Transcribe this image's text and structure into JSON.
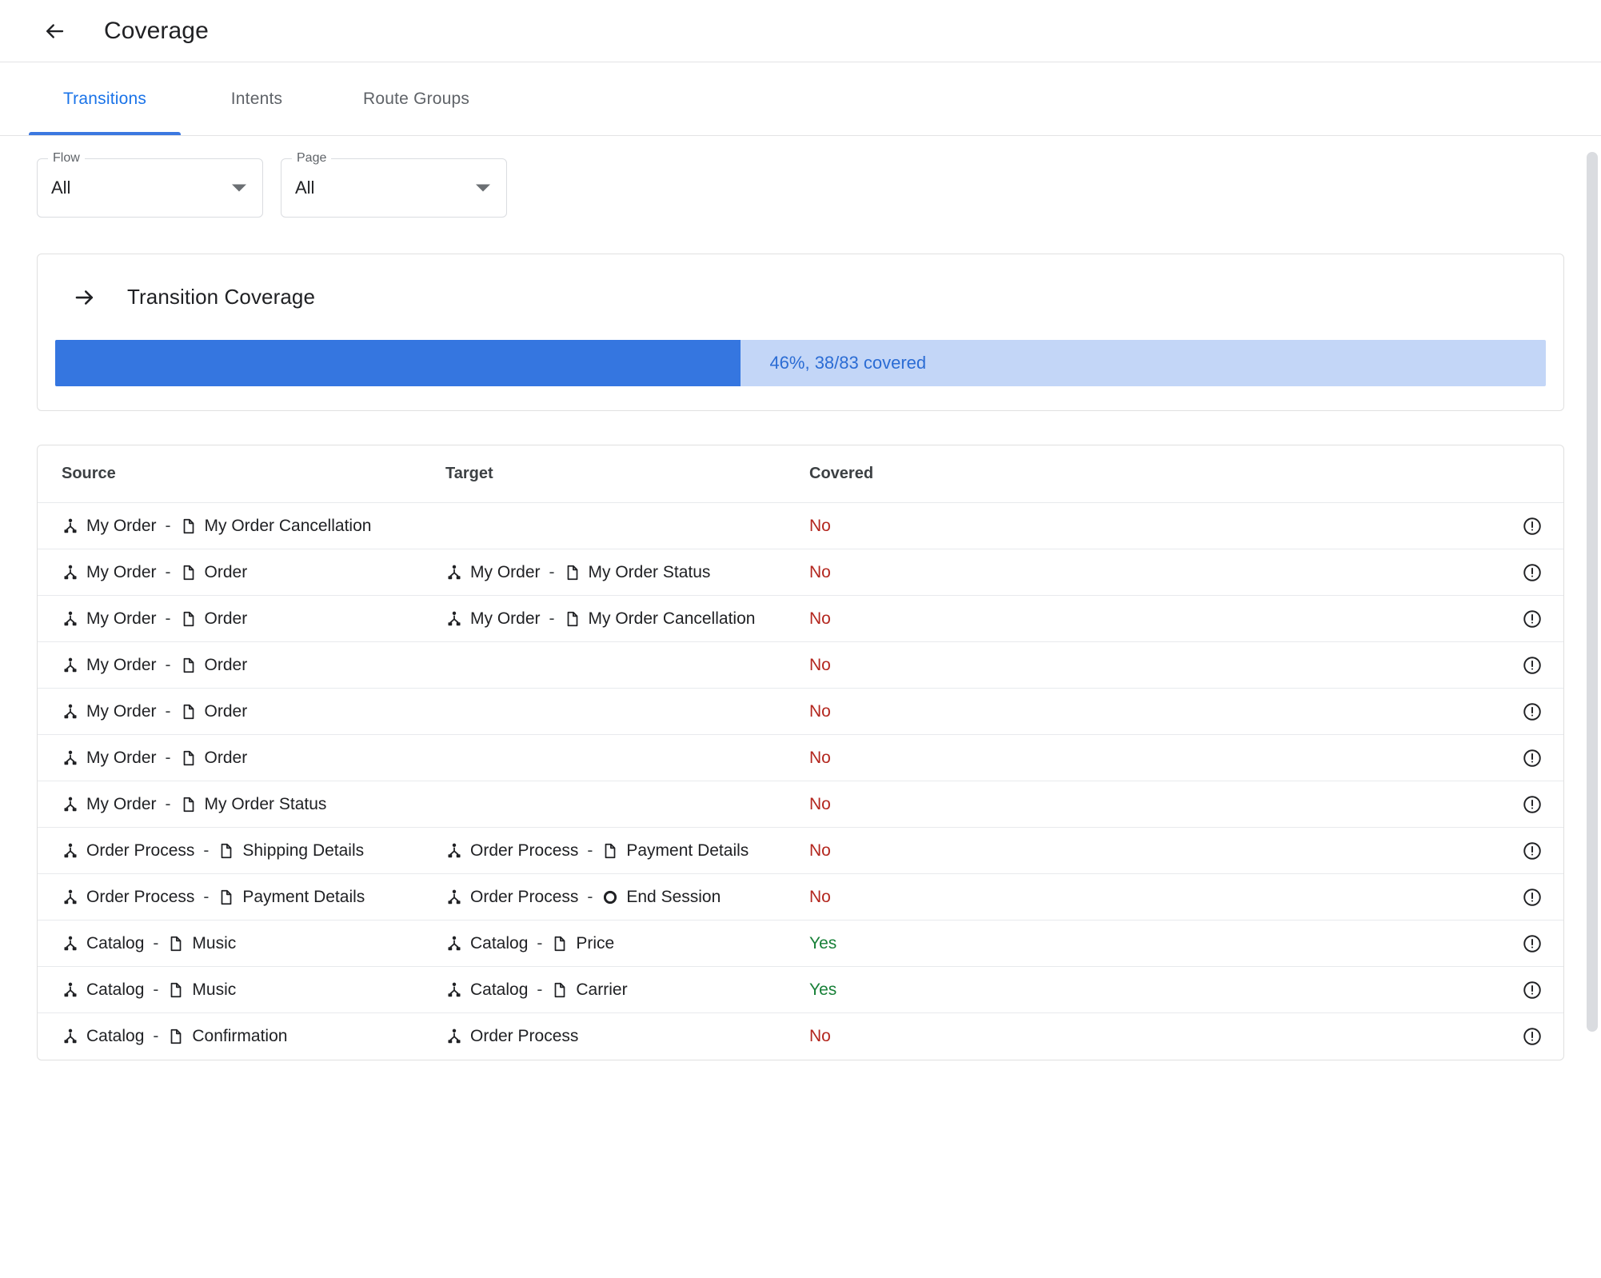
{
  "appbar": {
    "back_icon": "arrow-back-icon",
    "title": "Coverage"
  },
  "tabs": [
    {
      "label": "Transitions",
      "active": true
    },
    {
      "label": "Intents",
      "active": false
    },
    {
      "label": "Route Groups",
      "active": false
    }
  ],
  "filters": [
    {
      "label": "Flow",
      "value": "All",
      "icon": "chevron-down-icon"
    },
    {
      "label": "Page",
      "value": "All",
      "icon": "chevron-down-icon"
    }
  ],
  "coverage_card": {
    "icon": "arrow-forward-icon",
    "title": "Transition Coverage",
    "progress_text": "46%, 38/83 covered",
    "percent": 46,
    "covered_count": 38,
    "total_count": 83,
    "fill_color": "#3576e0",
    "track_color": "#c3d6f7",
    "text_color": "#2b6cd4"
  },
  "table": {
    "headers": {
      "source": "Source",
      "target": "Target",
      "covered": "Covered"
    },
    "colors": {
      "no": "#b3261e",
      "yes": "#188038"
    },
    "rows": [
      {
        "source": {
          "flow": "My Order",
          "node": "My Order Cancellation",
          "node_icon": "page-icon"
        },
        "target": null,
        "covered": "No",
        "flag_icon": "error-outline-icon"
      },
      {
        "source": {
          "flow": "My Order",
          "node": "Order",
          "node_icon": "page-icon"
        },
        "target": {
          "flow": "My Order",
          "node": "My Order Status",
          "node_icon": "page-icon"
        },
        "covered": "No",
        "flag_icon": "error-outline-icon"
      },
      {
        "source": {
          "flow": "My Order",
          "node": "Order",
          "node_icon": "page-icon"
        },
        "target": {
          "flow": "My Order",
          "node": "My Order Cancellation",
          "node_icon": "page-icon"
        },
        "covered": "No",
        "flag_icon": "error-outline-icon"
      },
      {
        "source": {
          "flow": "My Order",
          "node": "Order",
          "node_icon": "page-icon"
        },
        "target": null,
        "covered": "No",
        "flag_icon": "error-outline-icon"
      },
      {
        "source": {
          "flow": "My Order",
          "node": "Order",
          "node_icon": "page-icon"
        },
        "target": null,
        "covered": "No",
        "flag_icon": "error-outline-icon"
      },
      {
        "source": {
          "flow": "My Order",
          "node": "Order",
          "node_icon": "page-icon"
        },
        "target": null,
        "covered": "No",
        "flag_icon": "error-outline-icon"
      },
      {
        "source": {
          "flow": "My Order",
          "node": "My Order Status",
          "node_icon": "page-icon"
        },
        "target": null,
        "covered": "No",
        "flag_icon": "error-outline-icon"
      },
      {
        "source": {
          "flow": "Order Process",
          "node": "Shipping Details",
          "node_icon": "page-icon"
        },
        "target": {
          "flow": "Order Process",
          "node": "Payment Details",
          "node_icon": "page-icon"
        },
        "covered": "No",
        "flag_icon": "error-outline-icon"
      },
      {
        "source": {
          "flow": "Order Process",
          "node": "Payment Details",
          "node_icon": "page-icon"
        },
        "target": {
          "flow": "Order Process",
          "node": "End Session",
          "node_icon": "end-session-icon"
        },
        "covered": "No",
        "flag_icon": "error-outline-icon"
      },
      {
        "source": {
          "flow": "Catalog",
          "node": "Music",
          "node_icon": "page-icon"
        },
        "target": {
          "flow": "Catalog",
          "node": "Price",
          "node_icon": "page-icon"
        },
        "covered": "Yes",
        "flag_icon": "error-outline-icon"
      },
      {
        "source": {
          "flow": "Catalog",
          "node": "Music",
          "node_icon": "page-icon"
        },
        "target": {
          "flow": "Catalog",
          "node": "Carrier",
          "node_icon": "page-icon"
        },
        "covered": "Yes",
        "flag_icon": "error-outline-icon"
      },
      {
        "source": {
          "flow": "Catalog",
          "node": "Confirmation",
          "node_icon": "page-icon"
        },
        "target": {
          "flow": "Order Process",
          "node": "",
          "node_icon": null
        },
        "covered": "No",
        "flag_icon": "error-outline-icon"
      }
    ]
  },
  "scrollbar": {
    "name": "vertical-scrollbar"
  }
}
